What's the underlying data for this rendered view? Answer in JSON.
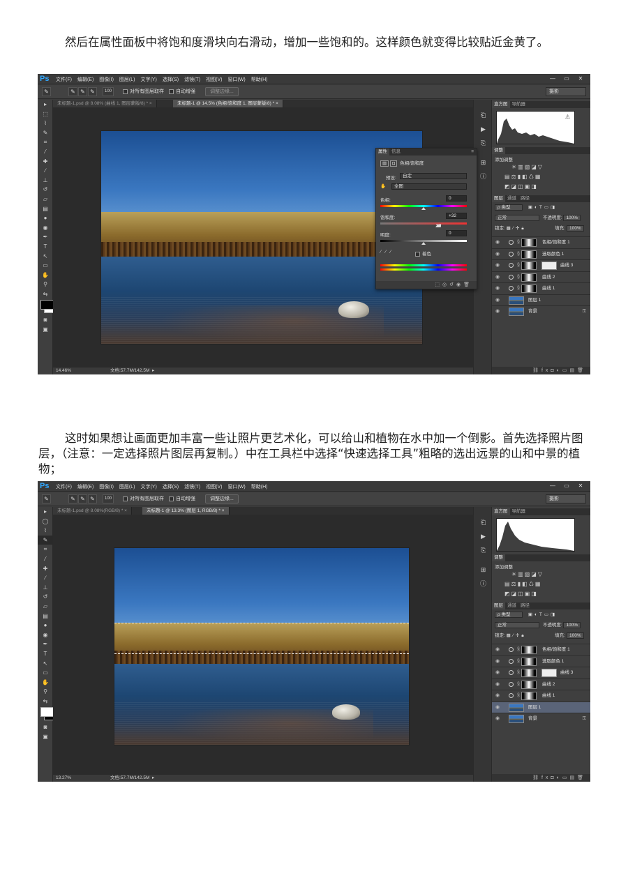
{
  "paragraph1": "然后在属性面板中将饱和度滑块向右滑动，增加一些饱和的。这样颜色就变得比较贴近金黄了。",
  "paragraph2": "这时如果想让画面更加丰富一些让照片更艺术化，可以给山和植物在水中加一个倒影。首先选择照片图层，（注意：一定选择照片图层再复制。）中在工具栏中选择“快速选择工具”粗略的选出远景的山和中景的植物；",
  "app": {
    "logo": "Ps",
    "menus": [
      "文件(F)",
      "编辑(E)",
      "图像(I)",
      "图层(L)",
      "文字(Y)",
      "选择(S)",
      "滤镜(T)",
      "视图(V)",
      "窗口(W)",
      "帮助(H)"
    ],
    "window_buttons": [
      "—",
      "▭",
      "✕"
    ],
    "options": {
      "brush_size": "100",
      "sample_all_layers": "对所有图层取样",
      "auto_enhance": "自动增强",
      "refine_edge": "调整边缘...",
      "workspace": "摄影"
    },
    "panel_tabs_top": [
      "直方图",
      "导航器"
    ],
    "adjustments_tab": "调整",
    "add_adjustment": "添加调整",
    "layers_tabs": [
      "图层",
      "通道",
      "路径"
    ],
    "layer_filter": "ρ 类型",
    "blend_mode": "正常",
    "opacity_label": "不透明度:",
    "opacity_value": "100%",
    "lock_label": "锁定:",
    "fill_label": "填充:",
    "fill_value": "100%",
    "doc_size": "文档:57.7M/142.5M"
  },
  "screenshot1": {
    "tabs": [
      "未标题-1.psd @ 8.08% (曲线 1, 图层蒙版/8) *  ×",
      "未标题-1 @ 14.5% (色相/饱和度 1, 图层蒙版/8) *  ×"
    ],
    "zoom": "14.46%",
    "layers": [
      {
        "name": "色相/饱和度 1",
        "kind": "adj",
        "selected": false
      },
      {
        "name": "选取颜色 1",
        "kind": "adj",
        "selected": false
      },
      {
        "name": "曲线 3",
        "kind": "adj2",
        "selected": false
      },
      {
        "name": "曲线 2",
        "kind": "adj",
        "selected": false
      },
      {
        "name": "曲线 1",
        "kind": "adj",
        "selected": false
      },
      {
        "name": "图层 1",
        "kind": "pic",
        "selected": false
      },
      {
        "name": "背景",
        "kind": "bg",
        "selected": false
      }
    ],
    "properties": {
      "tabs": [
        "属性",
        "信息"
      ],
      "title": "色相/饱和度",
      "preset_label": "预设:",
      "preset_value": "自定",
      "channel_value": "全图",
      "hue_label": "色相:",
      "hue_value": "0",
      "saturation_label": "饱和度:",
      "saturation_value": "+32",
      "lightness_label": "明度:",
      "lightness_value": "0",
      "colorize_label": "着色"
    }
  },
  "screenshot2": {
    "tabs": [
      "未标题-1.psd @ 8.08%(RGB/8) *  ×",
      "未标题-1 @ 13.3% (图层 1, RGB/8) *  ×"
    ],
    "zoom": "13.27%",
    "layers": [
      {
        "name": "色相/饱和度 1",
        "kind": "adj",
        "selected": false
      },
      {
        "name": "选取颜色 1",
        "kind": "adj",
        "selected": false
      },
      {
        "name": "曲线 3",
        "kind": "adj2",
        "selected": false
      },
      {
        "name": "曲线 2",
        "kind": "adj",
        "selected": false
      },
      {
        "name": "曲线 1",
        "kind": "adj",
        "selected": false
      },
      {
        "name": "图层 1",
        "kind": "pic",
        "selected": true
      },
      {
        "name": "背景",
        "kind": "bg",
        "selected": false
      }
    ]
  }
}
